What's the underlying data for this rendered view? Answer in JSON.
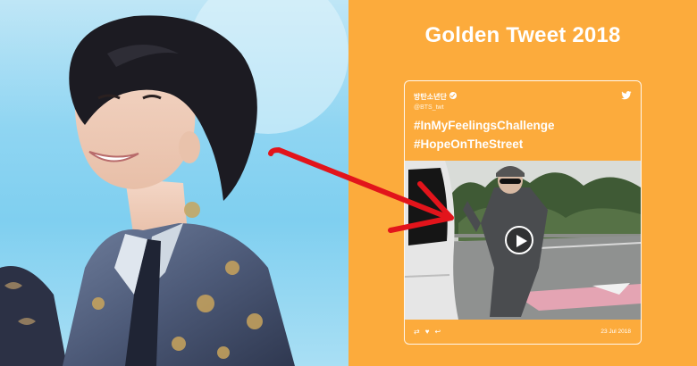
{
  "headline": "Golden Tweet 2018",
  "tweet": {
    "author_name": "방탄소년단",
    "author_handle": "@BTS_twt",
    "lines": [
      "#InMyFeelingsChallenge",
      "#HopeOnTheStreet"
    ],
    "date": "23 Jul 2018",
    "icons": {
      "bird": "twitter-bird-icon",
      "retweet": "retweet-icon",
      "like": "heart-icon",
      "reply": "reply-icon",
      "play": "play-icon"
    }
  },
  "colors": {
    "panel_orange": "#fcab3c",
    "arrow_red": "#e2141b",
    "sky_blue": "#8fd5f2"
  }
}
